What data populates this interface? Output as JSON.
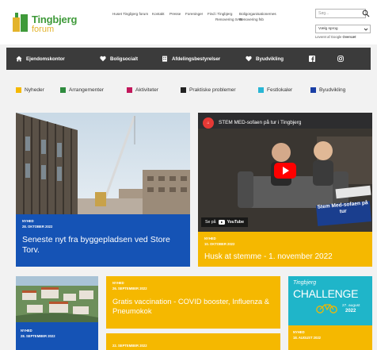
{
  "header": {
    "logo_title": "Tingbjerg",
    "logo_sub": "forum",
    "topnav": [
      "Huset Tingbjerg forum",
      "Kontakt",
      "Presse",
      "Foreninger",
      "Find i Tingbjerg",
      "Boligorganisationernes",
      "Renovering SAB",
      "Renovering fsb"
    ],
    "search_placeholder": "Søg...",
    "lang_select": "Vælg sprog",
    "translate_note_pre": "Leveret af Google",
    "translate_note_brand": "Oversæt"
  },
  "mainnav": [
    {
      "label": "Ejendomskontor",
      "icon": "home-icon"
    },
    {
      "label": "Boligsocialt",
      "icon": "heart-icon"
    },
    {
      "label": "Afdelingsbestyrelser",
      "icon": "building-icon"
    },
    {
      "label": "Byudvikling",
      "icon": "heart-icon"
    },
    {
      "label": "",
      "icon": "facebook-icon"
    },
    {
      "label": "",
      "icon": "instagram-icon"
    }
  ],
  "categories": [
    {
      "label": "Nyheder",
      "color": "#f5b800"
    },
    {
      "label": "Arrangementer",
      "color": "#2e8b3e"
    },
    {
      "label": "Aktiviteter",
      "color": "#c2185b"
    },
    {
      "label": "Praktiske problemer",
      "color": "#222222"
    },
    {
      "label": "Festlokaler",
      "color": "#29b6d5"
    },
    {
      "label": "Byudvikling",
      "color": "#1a3fa5"
    }
  ],
  "cards": {
    "c1": {
      "tag": "Nyhed",
      "date": "28. oktober 2022",
      "title": "Seneste nyt fra byggepladsen ved Store Torv."
    },
    "c2": {
      "tag": "Nyhed",
      "date": "10. oktober 2022",
      "title": "Husk at stemme - 1. november 2022",
      "video_title": "STEM MED-sofaen på tur i Tingbjerg",
      "video_caption": "Stem Med-sofaen på tur",
      "watch_pre": "Se på",
      "watch_brand": "YouTube"
    },
    "c3": {
      "tag": "Nyhed",
      "date": "28. september 2022"
    },
    "c4": {
      "tag": "Nyhed",
      "date": "26. september 2022",
      "title": "Gratis vaccination - COVID booster, Influenza & Pneumokok",
      "date2": "22. september 2022"
    },
    "c5": {
      "brand": "Tingbjerg",
      "title": "CHALLENGE",
      "date_label": "27. august",
      "year": "2022",
      "tag": "Nyhed",
      "date": "18. august 2022"
    }
  },
  "colors": {
    "yellow": "#f5b800",
    "blue": "#1553b5",
    "teal": "#1fb5c9",
    "nav": "#3b3b3b"
  }
}
